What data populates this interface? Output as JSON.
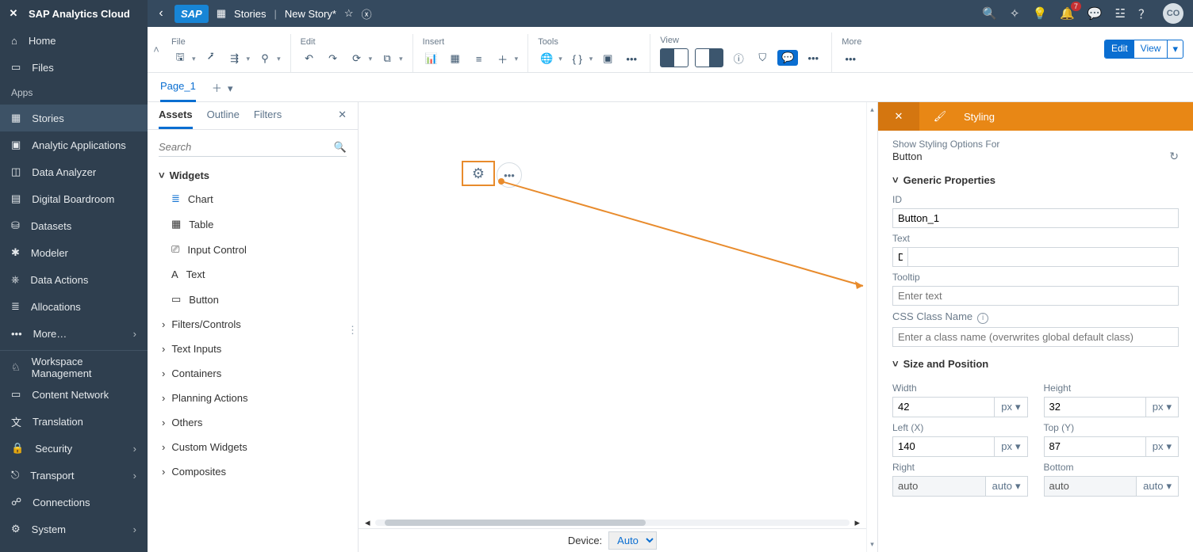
{
  "brand": "SAP Analytics Cloud",
  "nav": {
    "home": "Home",
    "files": "Files",
    "apps": "Apps",
    "stories": "Stories",
    "analytic": "Analytic Applications",
    "dataAnalyzer": "Data Analyzer",
    "boardroom": "Digital Boardroom",
    "datasets": "Datasets",
    "modeler": "Modeler",
    "dataActions": "Data Actions",
    "allocations": "Allocations",
    "more": "More…",
    "workspace": "Workspace Management",
    "contentNetwork": "Content Network",
    "translation": "Translation",
    "security": "Security",
    "transport": "Transport",
    "connections": "Connections",
    "system": "System"
  },
  "header": {
    "stories": "Stories",
    "storyName": "New Story",
    "dirty": "*",
    "avatar": "CO",
    "notif": "7"
  },
  "ribbon": {
    "file": "File",
    "edit": "Edit",
    "insert": "Insert",
    "tools": "Tools",
    "view": "View",
    "more": "More",
    "editBtn": "Edit",
    "viewBtn": "View"
  },
  "pages": {
    "page1": "Page_1"
  },
  "assets": {
    "tabs": {
      "assets": "Assets",
      "outline": "Outline",
      "filters": "Filters"
    },
    "search": "Search",
    "widgets": "Widgets",
    "chart": "Chart",
    "table": "Table",
    "inputControl": "Input Control",
    "text": "Text",
    "button": "Button",
    "filtersControls": "Filters/Controls",
    "textInputs": "Text Inputs",
    "containers": "Containers",
    "planning": "Planning Actions",
    "others": "Others",
    "customWidgets": "Custom Widgets",
    "composites": "Composites"
  },
  "device": {
    "label": "Device:",
    "value": "Auto"
  },
  "styling": {
    "tab": "Styling",
    "showFor": "Show Styling Options For",
    "kind": "Button",
    "generic": "Generic Properties",
    "idLabel": "ID",
    "id": "Button_1",
    "textLabel": "Text",
    "textVal": "D",
    "tooltipLabel": "Tooltip",
    "tooltipPh": "Enter text",
    "cssLabel": "CSS Class Name",
    "cssPh": "Enter a class name (overwrites global default class)",
    "sizePos": "Size and Position",
    "widthL": "Width",
    "width": "42",
    "heightL": "Height",
    "height": "32",
    "leftL": "Left (X)",
    "left": "140",
    "topL": "Top (Y)",
    "top": "87",
    "rightL": "Right",
    "right": "auto",
    "bottomL": "Bottom",
    "bottom": "auto",
    "px": "px"
  }
}
